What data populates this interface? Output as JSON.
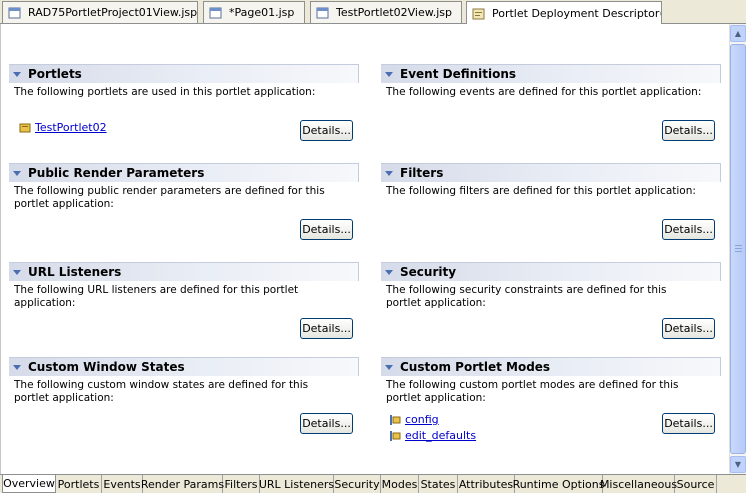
{
  "editor_tabs": [
    {
      "label": "RAD75PortletProject01View.jsp",
      "icon": "jsp-file-icon"
    },
    {
      "label": "*Page01.jsp",
      "icon": "jsp-file-icon"
    },
    {
      "label": "TestPortlet02View.jsp",
      "icon": "jsp-file-icon"
    },
    {
      "label": "Portlet Deployment Descriptor",
      "icon": "deployment-descriptor-icon",
      "close": "⊗"
    }
  ],
  "sections": {
    "portlets": {
      "title": "Portlets",
      "desc": "The following portlets are used in this portlet application:",
      "items": [
        "TestPortlet02"
      ],
      "button": "Details..."
    },
    "event_definitions": {
      "title": "Event Definitions",
      "desc": "The following events are defined for this portlet application:",
      "button": "Details..."
    },
    "public_render_params": {
      "title": "Public Render Parameters",
      "desc": "The following public render parameters are defined for this portlet application:",
      "button": "Details..."
    },
    "filters": {
      "title": "Filters",
      "desc": "The following filters are defined for this portlet application:",
      "button": "Details..."
    },
    "url_listeners": {
      "title": "URL Listeners",
      "desc": "The following URL listeners are defined for this portlet application:",
      "button": "Details..."
    },
    "security": {
      "title": "Security",
      "desc": "The following security constraints are defined for this portlet application:",
      "button": "Details..."
    },
    "custom_window_states": {
      "title": "Custom Window States",
      "desc": "The following custom window states are defined for this portlet application:",
      "button": "Details..."
    },
    "custom_portlet_modes": {
      "title": "Custom Portlet Modes",
      "desc": "The following custom portlet modes are defined for this portlet application:",
      "items": [
        "config",
        "edit_defaults"
      ],
      "button": "Details..."
    }
  },
  "bottom_tabs": [
    "Overview",
    "Portlets",
    "Events",
    "Render Params",
    "Filters",
    "URL Listeners",
    "Security",
    "Modes",
    "States",
    "Attributes",
    "Runtime Options",
    "Miscellaneous",
    "Source"
  ],
  "active_bottom_tab": "Overview",
  "colors": {
    "section_header": "#d6dbe9",
    "link": "#0000cc",
    "chrome": "#ece9d8",
    "accent": "#4a6eb2"
  }
}
